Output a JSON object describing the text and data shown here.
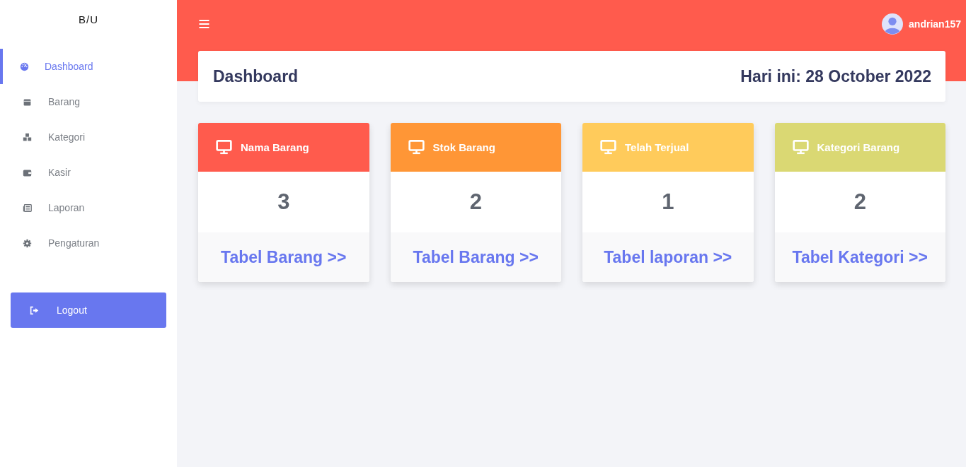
{
  "sidebar": {
    "brand": "B/U",
    "items": [
      {
        "label": "Dashboard",
        "kind": "dashboard",
        "selected": true
      },
      {
        "label": "Barang",
        "kind": "box",
        "selected": false
      },
      {
        "label": "Kategori",
        "kind": "boxes",
        "selected": false
      },
      {
        "label": "Kasir",
        "kind": "wallet",
        "selected": false
      },
      {
        "label": "Laporan",
        "kind": "report",
        "selected": false
      },
      {
        "label": "Pengaturan",
        "kind": "gear",
        "selected": false
      }
    ],
    "logout": "Logout"
  },
  "topbar": {
    "user": "andrian157"
  },
  "header": {
    "title": "Dashboard",
    "date": "Hari ini: 28 October 2022"
  },
  "cards": [
    {
      "title": "Nama Barang",
      "color": "#ff5b4d",
      "value": "3",
      "link": "Tabel Barang >>"
    },
    {
      "title": "Stok Barang",
      "color": "#ff9636",
      "value": "2",
      "link": "Tabel Barang >>"
    },
    {
      "title": "Telah Terjual",
      "color": "#ffcb5b",
      "value": "1",
      "link": "Tabel laporan >>"
    },
    {
      "title": "Kategori Barang",
      "color": "#dad873",
      "value": "2",
      "link": "Tabel Kategori >>"
    }
  ]
}
